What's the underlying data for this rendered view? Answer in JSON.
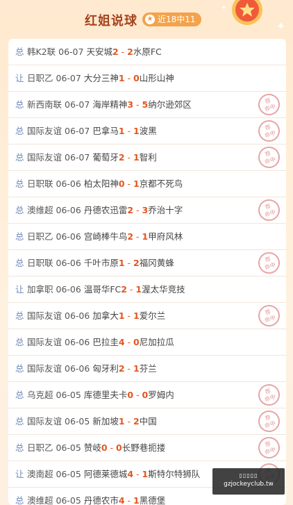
{
  "header": {
    "title": "红姐说球",
    "badge": "近18中11"
  },
  "colors": {
    "score": "#e3561f",
    "type": "#6b86b8",
    "badge": "#f3a34a",
    "stamp": "#e7a4a4"
  },
  "stamp_text": {
    "line1": "荐",
    "line2": "命中"
  },
  "watermark": {
    "line1": "▯▯▯▯▯",
    "line2": "gzjockeyclub.tw"
  },
  "matches": [
    {
      "type": "总",
      "league": "韩K2联",
      "date": "06-07",
      "home": "天安城",
      "hs": "2",
      "as": "2",
      "away": "水原FC",
      "hit": false
    },
    {
      "type": "让",
      "league": "日职乙",
      "date": "06-07",
      "home": "大分三神",
      "hs": "1",
      "as": "0",
      "away": "山形山神",
      "hit": false
    },
    {
      "type": "总",
      "league": "新西南联",
      "date": "06-07",
      "home": "海岸精神",
      "hs": "3",
      "as": "5",
      "away": "纳尔逊郊区",
      "hit": true
    },
    {
      "type": "总",
      "league": "国际友谊",
      "date": "06-07",
      "home": "巴拿马",
      "hs": "1",
      "as": "1",
      "away": "波黑",
      "hit": true
    },
    {
      "type": "总",
      "league": "国际友谊",
      "date": "06-07",
      "home": "葡萄牙",
      "hs": "2",
      "as": "1",
      "away": "智利",
      "hit": true
    },
    {
      "type": "总",
      "league": "日职联",
      "date": "06-06",
      "home": "柏太阳神",
      "hs": "0",
      "as": "1",
      "away": "京都不死鸟",
      "hit": false
    },
    {
      "type": "总",
      "league": "澳维超",
      "date": "06-06",
      "home": "丹德农迅雷",
      "hs": "2",
      "as": "3",
      "away": "乔治十字",
      "hit": true
    },
    {
      "type": "总",
      "league": "日职乙",
      "date": "06-06",
      "home": "宫崎棒牛鸟",
      "hs": "2",
      "as": "1",
      "away": "甲府风林",
      "hit": false
    },
    {
      "type": "总",
      "league": "日职联",
      "date": "06-06",
      "home": "千叶市原",
      "hs": "1",
      "as": "2",
      "away": "福冈黄蜂",
      "hit": true
    },
    {
      "type": "让",
      "league": "加拿职",
      "date": "06-06",
      "home": "温哥华FC",
      "hs": "2",
      "as": "1",
      "away": "渥太华竞技",
      "hit": false
    },
    {
      "type": "总",
      "league": "国际友谊",
      "date": "06-06",
      "home": "加拿大",
      "hs": "1",
      "as": "1",
      "away": "爱尔兰",
      "hit": true
    },
    {
      "type": "总",
      "league": "国际友谊",
      "date": "06-06",
      "home": "巴拉圭",
      "hs": "4",
      "as": "0",
      "away": "尼加拉瓜",
      "hit": false
    },
    {
      "type": "总",
      "league": "国际友谊",
      "date": "06-06",
      "home": "匈牙利",
      "hs": "2",
      "as": "1",
      "away": "芬兰",
      "hit": false
    },
    {
      "type": "总",
      "league": "乌克超",
      "date": "06-05",
      "home": "库德里夫卡",
      "hs": "0",
      "as": "0",
      "away": "罗姆内",
      "hit": true
    },
    {
      "type": "总",
      "league": "国际友谊",
      "date": "06-05",
      "home": "新加坡",
      "hs": "1",
      "as": "2",
      "away": "中国",
      "hit": true
    },
    {
      "type": "总",
      "league": "日职乙",
      "date": "06-05",
      "home": "赞岐",
      "hs": "0",
      "as": "0",
      "away": "长野巷扼搂",
      "hit": true
    },
    {
      "type": "让",
      "league": "澳南超",
      "date": "06-05",
      "home": "阿德莱德城",
      "hs": "4",
      "as": "1",
      "away": "斯特尔特狮队",
      "hit": true
    },
    {
      "type": "总",
      "league": "澳维超",
      "date": "06-05",
      "home": "丹德农市",
      "hs": "4",
      "as": "1",
      "away": "黑德堡",
      "hit": false
    }
  ]
}
